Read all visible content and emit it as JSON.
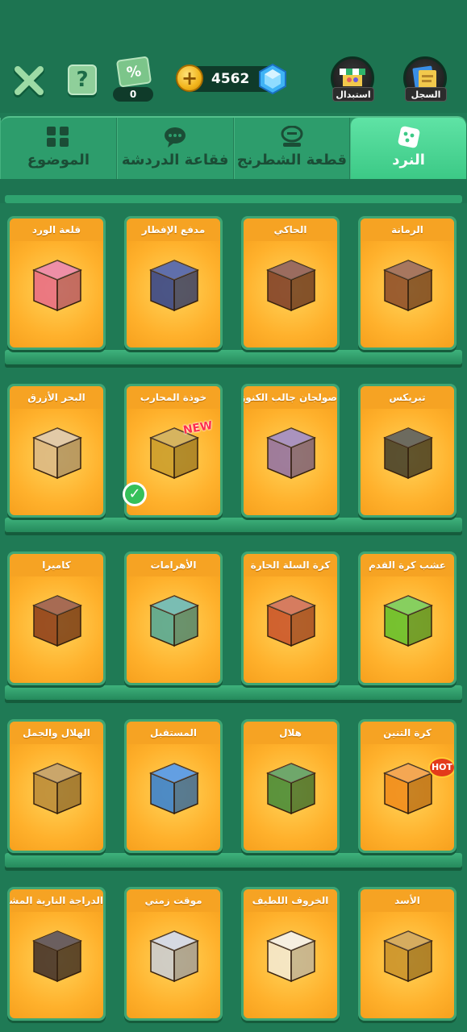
{
  "header": {
    "coupon_count": "0",
    "coupon_symbol": "%",
    "balance": "4562",
    "help_symbol": "?",
    "coin_symbol": "+",
    "store_label": "استبدال",
    "record_label": "السجل"
  },
  "tabs": [
    {
      "label": "الموضوع",
      "icon": "grid-icon",
      "active": false
    },
    {
      "label": "فقاعة الدردشة",
      "icon": "chat-bubble-icon",
      "active": false
    },
    {
      "label": "قطعة الشطرنج",
      "icon": "chess-piece-icon",
      "active": false
    },
    {
      "label": "النرد",
      "icon": "dice-icon",
      "active": true
    }
  ],
  "items": [
    {
      "title": "قلعة الورد",
      "icon": "rose-dice-icon",
      "color": "#e86a8a"
    },
    {
      "title": "مدفع الإفطار",
      "icon": "cannon-dice-icon",
      "color": "#2b3f8f"
    },
    {
      "title": "الحاكي",
      "icon": "gramophone-dice-icon",
      "color": "#7a3b2a"
    },
    {
      "title": "الرمانة",
      "icon": "pomegranate-dice-icon",
      "color": "#8a4a2a"
    },
    {
      "title": "البحر الأزرق",
      "icon": "anchor-dice-icon",
      "color": "#d9b98a"
    },
    {
      "title": "خوذة المحارب",
      "icon": "helmet-dice-icon",
      "color": "#c99b2a",
      "badge": "NEW",
      "selected": true
    },
    {
      "title": "صولجان جالب الكنوز",
      "icon": "scepter-dice-icon",
      "color": "#8e6fa8"
    },
    {
      "title": "تيريكس",
      "icon": "trex-dice-icon",
      "color": "#3d3a2a"
    },
    {
      "title": "كاميرا",
      "icon": "camera-dice-icon",
      "color": "#8a3a1a"
    },
    {
      "title": "الأهرامات",
      "icon": "pyramid-dice-icon",
      "color": "#4ea79a"
    },
    {
      "title": "كرة السلة الحارة",
      "icon": "basketball-dice-icon",
      "color": "#c8502a"
    },
    {
      "title": "عشب كرة القدم",
      "icon": "soccer-dice-icon",
      "color": "#5fbf2a"
    },
    {
      "title": "الهلال والجمل",
      "icon": "camel-dice-icon",
      "color": "#b8893a"
    },
    {
      "title": "المستقبل",
      "icon": "future-dice-icon",
      "color": "#2f7fd8"
    },
    {
      "title": "هلال",
      "icon": "crescent-dice-icon",
      "color": "#3f8a3a"
    },
    {
      "title": "كرة التنين",
      "icon": "dragon-dice-icon",
      "color": "#f08a1a",
      "badge": "HOT"
    },
    {
      "title": "الدراجة النارية المشتعلة",
      "icon": "motorbike-dice-icon",
      "color": "#3a2a2a"
    },
    {
      "title": "موقت زمني",
      "icon": "timer-dice-icon",
      "color": "#c8ccd8"
    },
    {
      "title": "الخروف اللطيف",
      "icon": "sheep-dice-icon",
      "color": "#f3ead6"
    },
    {
      "title": "الأسد",
      "icon": "lion-dice-icon",
      "color": "#c8902a"
    }
  ]
}
